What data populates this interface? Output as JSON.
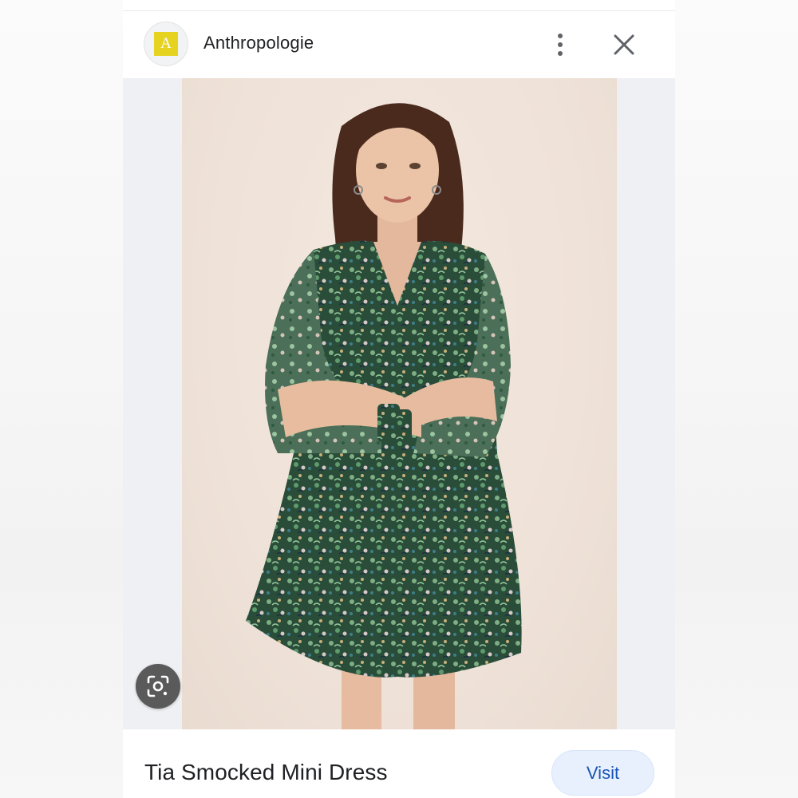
{
  "source": {
    "logo_letter": "A",
    "name": "Anthropologie",
    "logo_color": "#e5d31f"
  },
  "header_icons": {
    "more": "more-vert-icon",
    "close": "close-icon"
  },
  "image": {
    "lens_icon": "google-lens-icon"
  },
  "product": {
    "title": "Tia Smocked Mini Dress"
  },
  "actions": {
    "visit_label": "Visit"
  },
  "colors": {
    "accent": "#1a56b5",
    "visit_bg": "#e8f0fe",
    "dress_green": "#2f5a3f"
  }
}
